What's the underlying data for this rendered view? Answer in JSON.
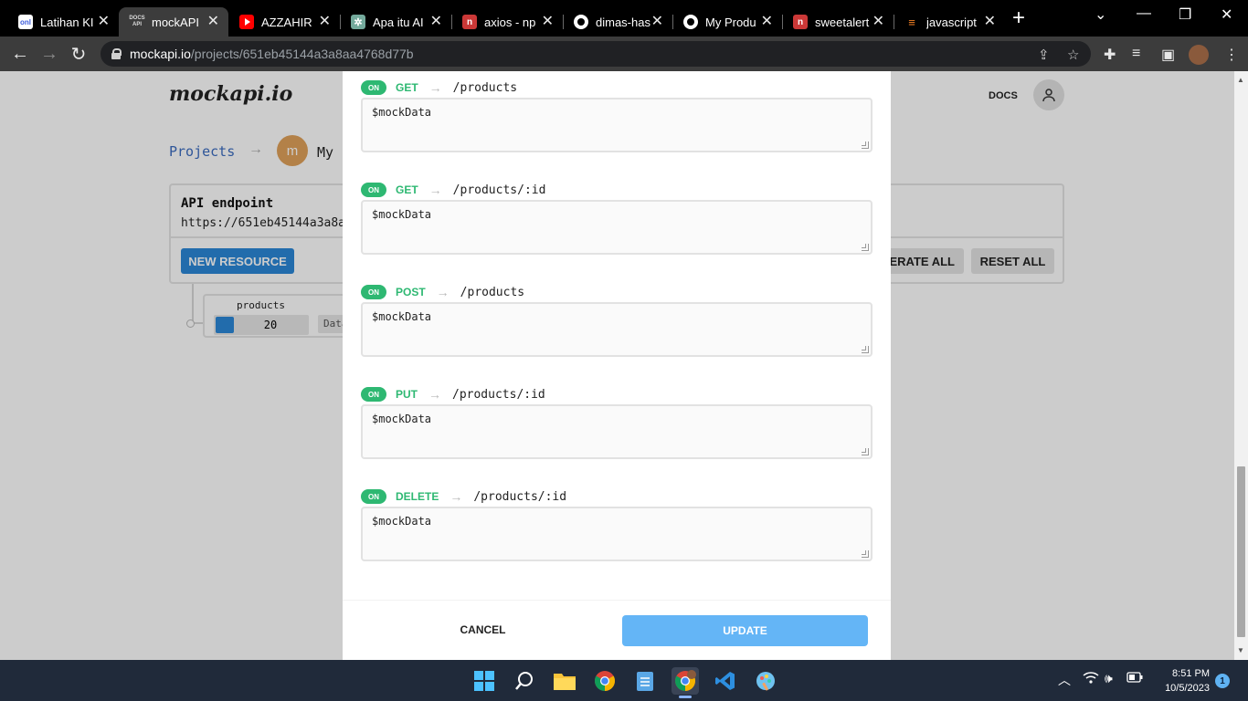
{
  "browser": {
    "tabs": [
      {
        "label": "Latihan KI",
        "favicon": "onl"
      },
      {
        "label": "mockAPI",
        "favicon": "API"
      },
      {
        "label": "AZZAHIR",
        "favicon": "youtube"
      },
      {
        "label": "Apa itu AI",
        "favicon": "chatgpt"
      },
      {
        "label": "axios - np",
        "favicon": "npm"
      },
      {
        "label": "dimas-has",
        "favicon": "github"
      },
      {
        "label": "My Produ",
        "favicon": "github"
      },
      {
        "label": "sweetalert",
        "favicon": "npm"
      },
      {
        "label": "javascript",
        "favicon": "stackoverflow"
      }
    ],
    "active_tab_index": 1,
    "url_host": "mockapi.io",
    "url_path": "/projects/651eb45144a3a8aa4768d77b"
  },
  "page": {
    "logo": "mockapi.io",
    "docs_link": "DOCS",
    "breadcrumb_projects": "Projects",
    "project_avatar_letter": "m",
    "project_name_partial": "My",
    "api_endpoint_title": "API endpoint",
    "api_endpoint_url": "https://651eb45144a3a8a",
    "new_resource_button": "NEW RESOURCE",
    "generate_all_button": "GENERATE ALL",
    "reset_all_button": "RESET ALL",
    "resource_name": "products",
    "resource_count": "20",
    "resource_data_label": "Data"
  },
  "modal": {
    "endpoints": [
      {
        "toggle": "ON",
        "method": "GET",
        "path": "/products",
        "body": "$mockData"
      },
      {
        "toggle": "ON",
        "method": "GET",
        "path": "/products/:id",
        "body": "$mockData"
      },
      {
        "toggle": "ON",
        "method": "POST",
        "path": "/products",
        "body": "$mockData"
      },
      {
        "toggle": "ON",
        "method": "PUT",
        "path": "/products/:id",
        "body": "$mockData"
      },
      {
        "toggle": "ON",
        "method": "DELETE",
        "path": "/products/:id",
        "body": "$mockData"
      }
    ],
    "cancel_button": "CANCEL",
    "update_button": "UPDATE"
  },
  "taskbar": {
    "time": "8:51 PM",
    "date": "10/5/2023",
    "notification_count": "1"
  },
  "colors": {
    "method_green": "#2eb872",
    "primary_blue": "#2b87d8",
    "update_blue": "#64b5f6"
  }
}
